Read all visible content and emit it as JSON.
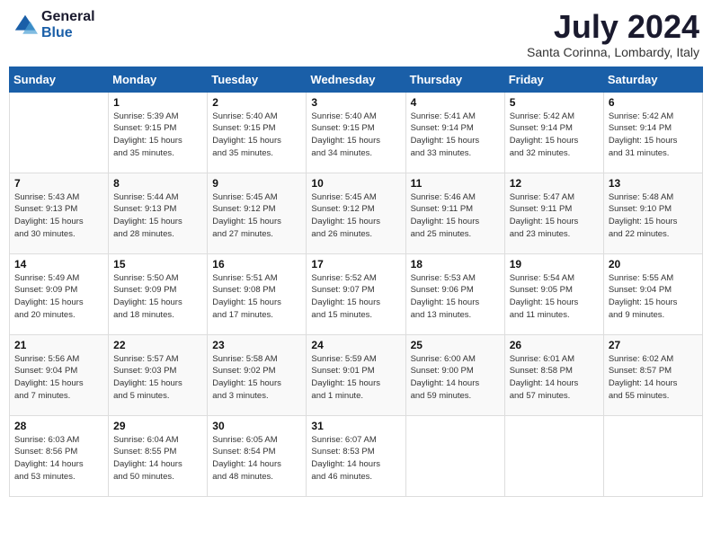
{
  "header": {
    "logo_line1": "General",
    "logo_line2": "Blue",
    "month_title": "July 2024",
    "subtitle": "Santa Corinna, Lombardy, Italy"
  },
  "weekdays": [
    "Sunday",
    "Monday",
    "Tuesday",
    "Wednesday",
    "Thursday",
    "Friday",
    "Saturday"
  ],
  "weeks": [
    [
      {
        "day": "",
        "info": ""
      },
      {
        "day": "1",
        "info": "Sunrise: 5:39 AM\nSunset: 9:15 PM\nDaylight: 15 hours\nand 35 minutes."
      },
      {
        "day": "2",
        "info": "Sunrise: 5:40 AM\nSunset: 9:15 PM\nDaylight: 15 hours\nand 35 minutes."
      },
      {
        "day": "3",
        "info": "Sunrise: 5:40 AM\nSunset: 9:15 PM\nDaylight: 15 hours\nand 34 minutes."
      },
      {
        "day": "4",
        "info": "Sunrise: 5:41 AM\nSunset: 9:14 PM\nDaylight: 15 hours\nand 33 minutes."
      },
      {
        "day": "5",
        "info": "Sunrise: 5:42 AM\nSunset: 9:14 PM\nDaylight: 15 hours\nand 32 minutes."
      },
      {
        "day": "6",
        "info": "Sunrise: 5:42 AM\nSunset: 9:14 PM\nDaylight: 15 hours\nand 31 minutes."
      }
    ],
    [
      {
        "day": "7",
        "info": "Sunrise: 5:43 AM\nSunset: 9:13 PM\nDaylight: 15 hours\nand 30 minutes."
      },
      {
        "day": "8",
        "info": "Sunrise: 5:44 AM\nSunset: 9:13 PM\nDaylight: 15 hours\nand 28 minutes."
      },
      {
        "day": "9",
        "info": "Sunrise: 5:45 AM\nSunset: 9:12 PM\nDaylight: 15 hours\nand 27 minutes."
      },
      {
        "day": "10",
        "info": "Sunrise: 5:45 AM\nSunset: 9:12 PM\nDaylight: 15 hours\nand 26 minutes."
      },
      {
        "day": "11",
        "info": "Sunrise: 5:46 AM\nSunset: 9:11 PM\nDaylight: 15 hours\nand 25 minutes."
      },
      {
        "day": "12",
        "info": "Sunrise: 5:47 AM\nSunset: 9:11 PM\nDaylight: 15 hours\nand 23 minutes."
      },
      {
        "day": "13",
        "info": "Sunrise: 5:48 AM\nSunset: 9:10 PM\nDaylight: 15 hours\nand 22 minutes."
      }
    ],
    [
      {
        "day": "14",
        "info": "Sunrise: 5:49 AM\nSunset: 9:09 PM\nDaylight: 15 hours\nand 20 minutes."
      },
      {
        "day": "15",
        "info": "Sunrise: 5:50 AM\nSunset: 9:09 PM\nDaylight: 15 hours\nand 18 minutes."
      },
      {
        "day": "16",
        "info": "Sunrise: 5:51 AM\nSunset: 9:08 PM\nDaylight: 15 hours\nand 17 minutes."
      },
      {
        "day": "17",
        "info": "Sunrise: 5:52 AM\nSunset: 9:07 PM\nDaylight: 15 hours\nand 15 minutes."
      },
      {
        "day": "18",
        "info": "Sunrise: 5:53 AM\nSunset: 9:06 PM\nDaylight: 15 hours\nand 13 minutes."
      },
      {
        "day": "19",
        "info": "Sunrise: 5:54 AM\nSunset: 9:05 PM\nDaylight: 15 hours\nand 11 minutes."
      },
      {
        "day": "20",
        "info": "Sunrise: 5:55 AM\nSunset: 9:04 PM\nDaylight: 15 hours\nand 9 minutes."
      }
    ],
    [
      {
        "day": "21",
        "info": "Sunrise: 5:56 AM\nSunset: 9:04 PM\nDaylight: 15 hours\nand 7 minutes."
      },
      {
        "day": "22",
        "info": "Sunrise: 5:57 AM\nSunset: 9:03 PM\nDaylight: 15 hours\nand 5 minutes."
      },
      {
        "day": "23",
        "info": "Sunrise: 5:58 AM\nSunset: 9:02 PM\nDaylight: 15 hours\nand 3 minutes."
      },
      {
        "day": "24",
        "info": "Sunrise: 5:59 AM\nSunset: 9:01 PM\nDaylight: 15 hours\nand 1 minute."
      },
      {
        "day": "25",
        "info": "Sunrise: 6:00 AM\nSunset: 9:00 PM\nDaylight: 14 hours\nand 59 minutes."
      },
      {
        "day": "26",
        "info": "Sunrise: 6:01 AM\nSunset: 8:58 PM\nDaylight: 14 hours\nand 57 minutes."
      },
      {
        "day": "27",
        "info": "Sunrise: 6:02 AM\nSunset: 8:57 PM\nDaylight: 14 hours\nand 55 minutes."
      }
    ],
    [
      {
        "day": "28",
        "info": "Sunrise: 6:03 AM\nSunset: 8:56 PM\nDaylight: 14 hours\nand 53 minutes."
      },
      {
        "day": "29",
        "info": "Sunrise: 6:04 AM\nSunset: 8:55 PM\nDaylight: 14 hours\nand 50 minutes."
      },
      {
        "day": "30",
        "info": "Sunrise: 6:05 AM\nSunset: 8:54 PM\nDaylight: 14 hours\nand 48 minutes."
      },
      {
        "day": "31",
        "info": "Sunrise: 6:07 AM\nSunset: 8:53 PM\nDaylight: 14 hours\nand 46 minutes."
      },
      {
        "day": "",
        "info": ""
      },
      {
        "day": "",
        "info": ""
      },
      {
        "day": "",
        "info": ""
      }
    ]
  ]
}
